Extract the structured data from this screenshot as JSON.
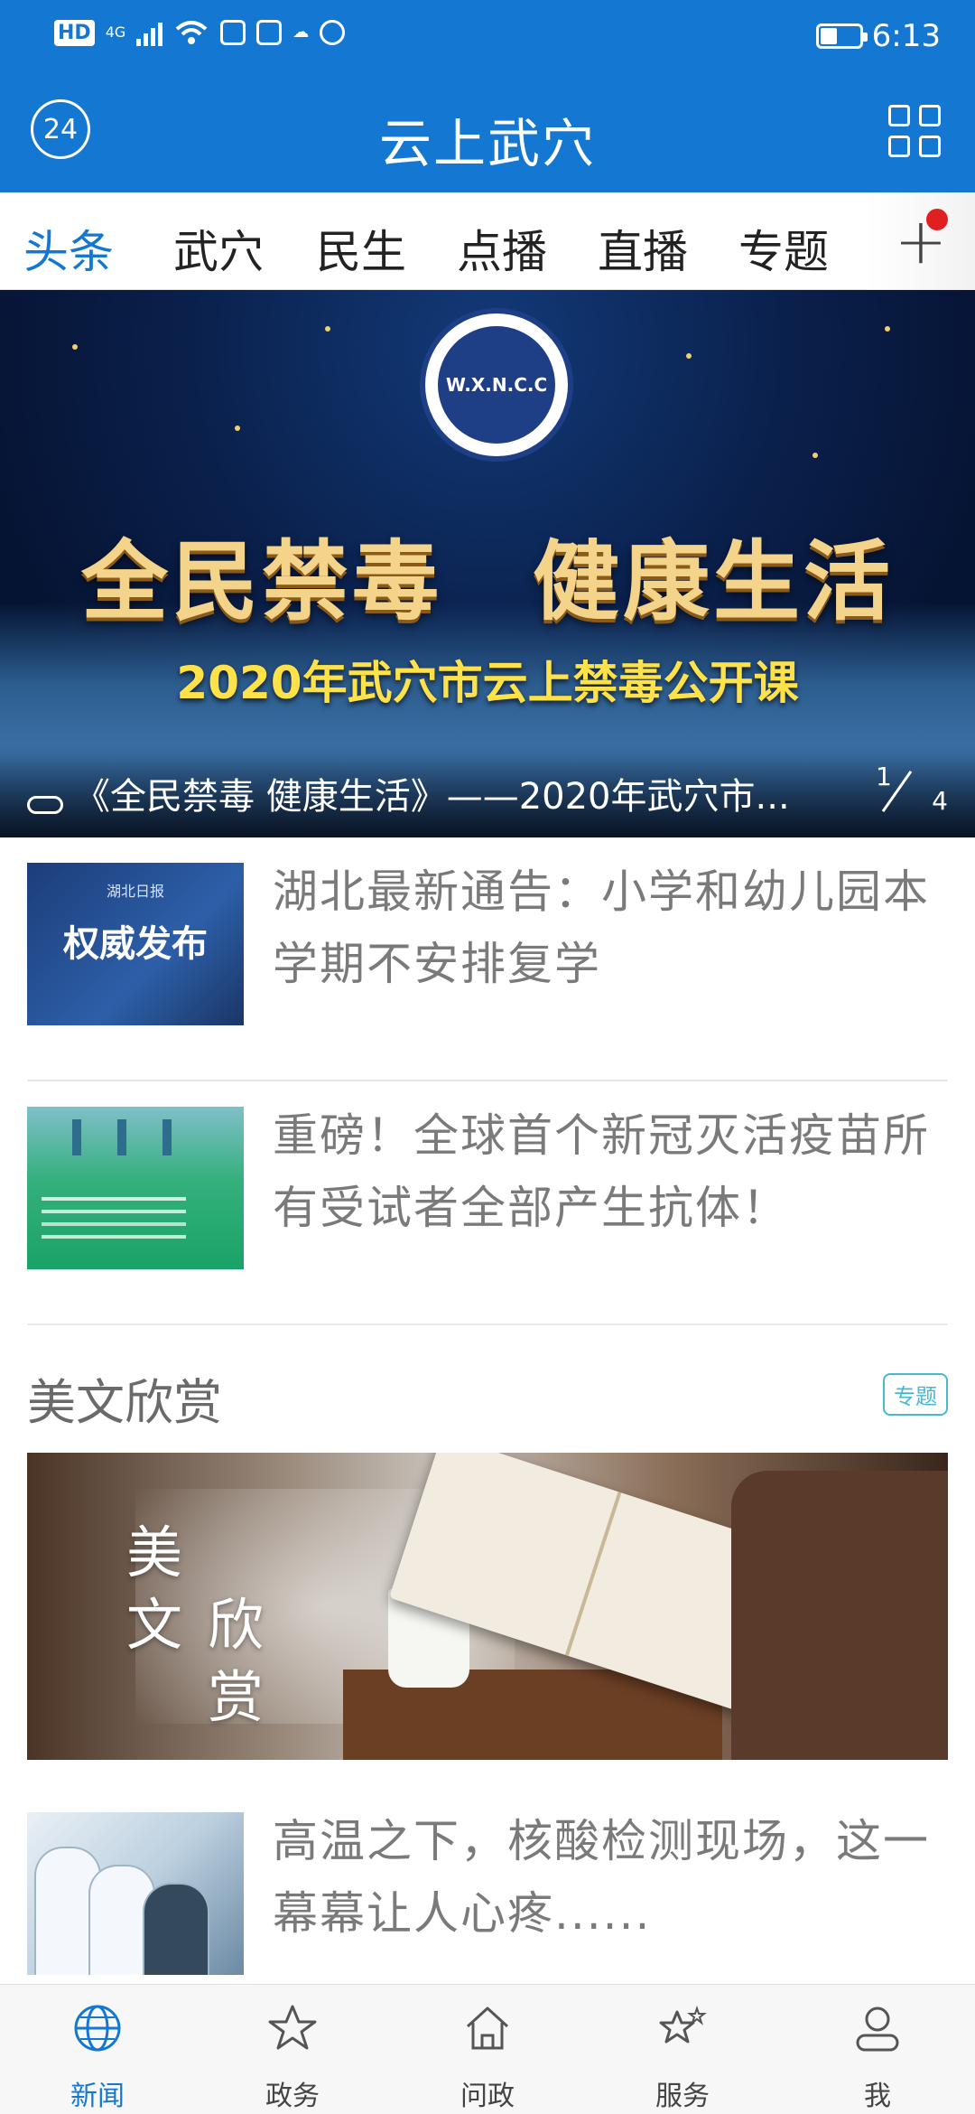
{
  "status_bar": {
    "left_icons": [
      "hd-icon",
      "4g-signal-icon",
      "wifi-icon",
      "app-icon",
      "app-icon",
      "app-icon",
      "shield-hand-icon"
    ],
    "hd": "HD",
    "net": "4G",
    "time": "6:13"
  },
  "header": {
    "title": "云上武穴",
    "left_icon": "24",
    "right_icon": "grid-icon"
  },
  "tabs": {
    "items": [
      "头条",
      "武穴",
      "民生",
      "点播",
      "直播",
      "专题"
    ],
    "active": "头条",
    "add": "+"
  },
  "banner": {
    "emblem_text": "W.X.N.C.C",
    "headline": "全民禁毒　健康生活",
    "subheadline": "2020年武穴市云上禁毒公开课",
    "caption": "《全民禁毒 健康生活》——2020年武穴市...",
    "page_current": "1",
    "page_total": "4"
  },
  "news": [
    {
      "title": "湖北最新通告：小学和幼儿园本学期不安排复学",
      "thumb_top": "湖北日报",
      "thumb_tag": "权威发布"
    },
    {
      "title": "重磅！全球首个新冠灭活疫苗所有受试者全部产生抗体！"
    }
  ],
  "section": {
    "title": "美文欣赏",
    "badge": "专题",
    "image_text": [
      "美",
      "文",
      "欣",
      "赏"
    ]
  },
  "news_bottom": {
    "title": "高温之下，核酸检测现场，这一幕幕让人心疼......"
  },
  "bottom_nav": {
    "items": [
      {
        "label": "新闻",
        "icon": "globe-icon"
      },
      {
        "label": "政务",
        "icon": "star-icon"
      },
      {
        "label": "问政",
        "icon": "home-icon"
      },
      {
        "label": "服务",
        "icon": "stars-icon"
      },
      {
        "label": "我",
        "icon": "person-icon"
      }
    ],
    "active": "新闻",
    "active_color": "#1478d2"
  },
  "colors": {
    "brand": "#1478d2",
    "badge": "#48b8d0",
    "notify_dot": "#e02020"
  }
}
